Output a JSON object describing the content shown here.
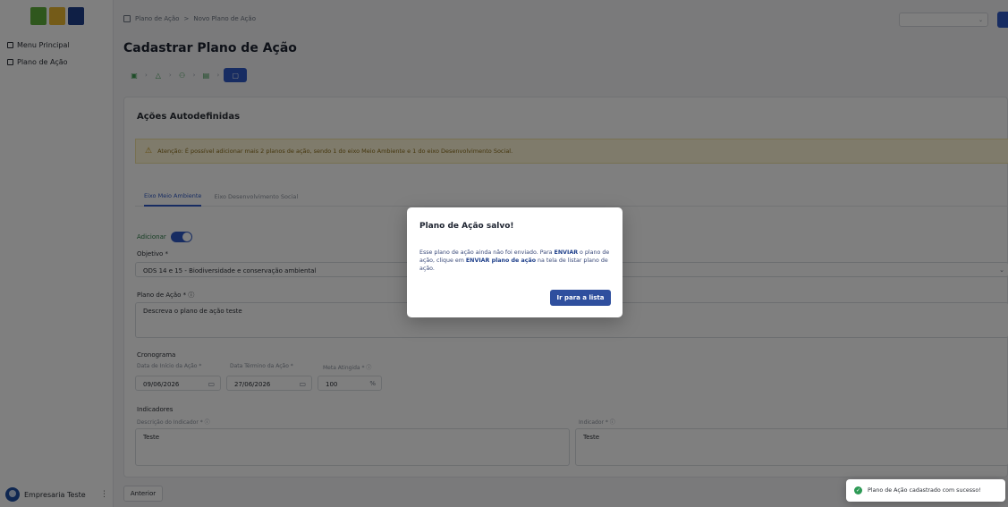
{
  "sidebar": {
    "items": [
      {
        "label": "Menu Principal",
        "icon": "grid-icon"
      },
      {
        "label": "Plano de Ação",
        "icon": "document-icon"
      }
    ],
    "user": {
      "name": "Empresaria Teste"
    }
  },
  "breadcrumb": {
    "items": [
      "Plano de Ação",
      "Novo Plano de Ação"
    ],
    "separator": ">"
  },
  "page": {
    "title": "Cadastrar Plano de Ação"
  },
  "card": {
    "title": "Ações Autodefinidas",
    "alert": "Atenção: É possível adicionar mais 2 planos de ação, sendo 1 do eixo Meio Ambiente e 1 do eixo Desenvolvimento Social.",
    "tabs": [
      "Eixo Meio Ambiente",
      "Eixo Desenvolvimento Social"
    ],
    "add_label": "Adicionar",
    "objective_label": "Objetivo *",
    "objective_value": "ODS 14 e 15 - Biodiversidade e conservação ambiental",
    "plan_label": "Plano de Ação * ⓘ",
    "plan_value": "Descreva o plano de ação teste",
    "schedule_label": "Cronograma",
    "start_label": "Data de Início da Ação *",
    "start_value": "09/06/2026",
    "end_label": "Data Término da Ação *",
    "end_value": "27/06/2026",
    "goal_label": "Meta Atingida * ⓘ",
    "goal_value": "100",
    "goal_unit": "%",
    "indicators_label": "Indicadores",
    "indicator_desc_label": "Descrição do Indicador * ⓘ",
    "indicator_desc_value": "Teste",
    "indicator_label": "Indicador * ⓘ",
    "indicator_value": "Teste"
  },
  "footer": {
    "prev_label": "Anterior"
  },
  "modal": {
    "title": "Plano de Ação salvo!",
    "body_1": "Esse plano de ação ainda não foi enviado. Para ",
    "body_enviar": "ENVIAR",
    "body_2": " o plano de ação, clique em ",
    "body_enviar_plano": "ENVIAR plano de ação",
    "body_3": " na tela de listar plano de ação.",
    "button": "Ir para a lista"
  },
  "toast": {
    "message": "Plano de Ação cadastrado com sucesso!",
    "icon": "check-circle-icon"
  },
  "colors": {
    "primary": "#2f59c4",
    "modal_button": "#2f4f9e",
    "success": "#2e9a56"
  }
}
